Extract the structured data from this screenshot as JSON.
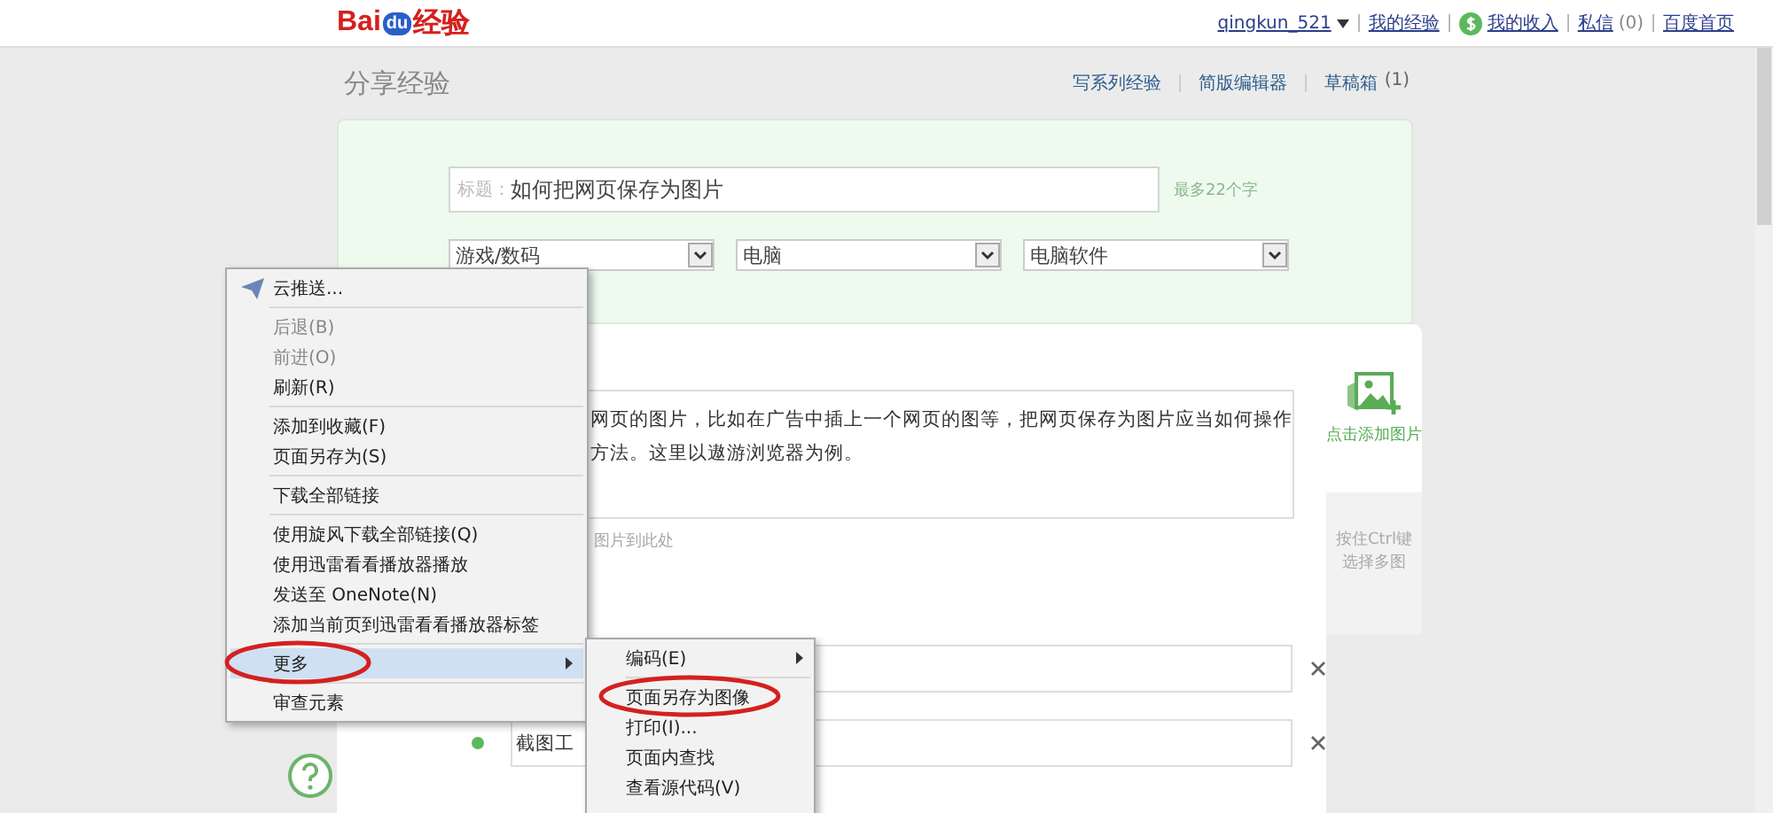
{
  "header": {
    "logo": [
      "Bai",
      "du",
      "经验"
    ],
    "user": "qingkun_521",
    "links": [
      {
        "label": "我的经验",
        "kind": "link"
      },
      {
        "label": "我的收入",
        "kind": "money"
      },
      {
        "label": "私信",
        "kind": "link",
        "count": "(0)"
      },
      {
        "label": "百度首页",
        "kind": "link"
      }
    ]
  },
  "page": {
    "title": "分享经验",
    "actions": [
      {
        "label": "写系列经验"
      },
      {
        "label": "简版编辑器"
      },
      {
        "label": "草稿箱",
        "count": "(1)"
      }
    ]
  },
  "form": {
    "title_label": "标题：",
    "title_value": "如何把网页保存为图片",
    "title_hint": "最多22个字",
    "categories": [
      "游戏/数码",
      "电脑",
      "电脑软件"
    ],
    "intro_lines": [
      "网页的图片，比如在广告中插上一个网页的图等，把网页保存为图片应当如何操作",
      "方法。这里以遨游浏览器为例。"
    ],
    "drop_hint": "图片到此处",
    "steps": [
      {
        "bullet": false
      },
      {
        "value": "截图工",
        "bullet": true
      }
    ]
  },
  "image_panel": {
    "add_label": "点击添加图片",
    "hint_lines": [
      "按住Ctrl键",
      "选择多图"
    ]
  },
  "context_menu": {
    "groups": [
      [
        {
          "label": "云推送...",
          "disabled": false,
          "icon": true,
          "submenu": false,
          "selected": false
        }
      ],
      [
        {
          "label": "后退(B)",
          "disabled": true,
          "icon": false,
          "submenu": false,
          "selected": false
        },
        {
          "label": "前进(O)",
          "disabled": true,
          "icon": false,
          "submenu": false,
          "selected": false
        },
        {
          "label": "刷新(R)",
          "disabled": false,
          "icon": false,
          "submenu": false,
          "selected": false
        }
      ],
      [
        {
          "label": "添加到收藏(F)",
          "disabled": false,
          "icon": false,
          "submenu": false,
          "selected": false
        },
        {
          "label": "页面另存为(S)",
          "disabled": false,
          "icon": false,
          "submenu": false,
          "selected": false
        }
      ],
      [
        {
          "label": "下载全部链接",
          "disabled": false,
          "icon": false,
          "submenu": false,
          "selected": false
        }
      ],
      [
        {
          "label": "使用旋风下载全部链接(Q)",
          "disabled": false,
          "icon": false,
          "submenu": false,
          "selected": false
        },
        {
          "label": "使用迅雷看看播放器播放",
          "disabled": false,
          "icon": false,
          "submenu": false,
          "selected": false
        },
        {
          "label": "发送至 OneNote(N)",
          "disabled": false,
          "icon": false,
          "submenu": false,
          "selected": false
        },
        {
          "label": "添加当前页到迅雷看看播放器标签",
          "disabled": false,
          "icon": false,
          "submenu": false,
          "selected": false
        }
      ],
      [
        {
          "label": "更多",
          "disabled": false,
          "icon": false,
          "submenu": true,
          "selected": true,
          "circled": true
        }
      ],
      [
        {
          "label": "审查元素",
          "disabled": false,
          "icon": false,
          "submenu": false,
          "selected": false
        }
      ]
    ]
  },
  "submenu": {
    "groups": [
      [
        {
          "label": "编码(E)",
          "submenu": true,
          "circled": false
        }
      ],
      [
        {
          "label": "页面另存为图像",
          "submenu": false,
          "circled": true
        },
        {
          "label": "打印(I)...",
          "submenu": false,
          "circled": false
        },
        {
          "label": "页面内查找",
          "submenu": false,
          "circled": false
        },
        {
          "label": "查看源代码(V)",
          "submenu": false,
          "circled": false
        }
      ]
    ]
  }
}
